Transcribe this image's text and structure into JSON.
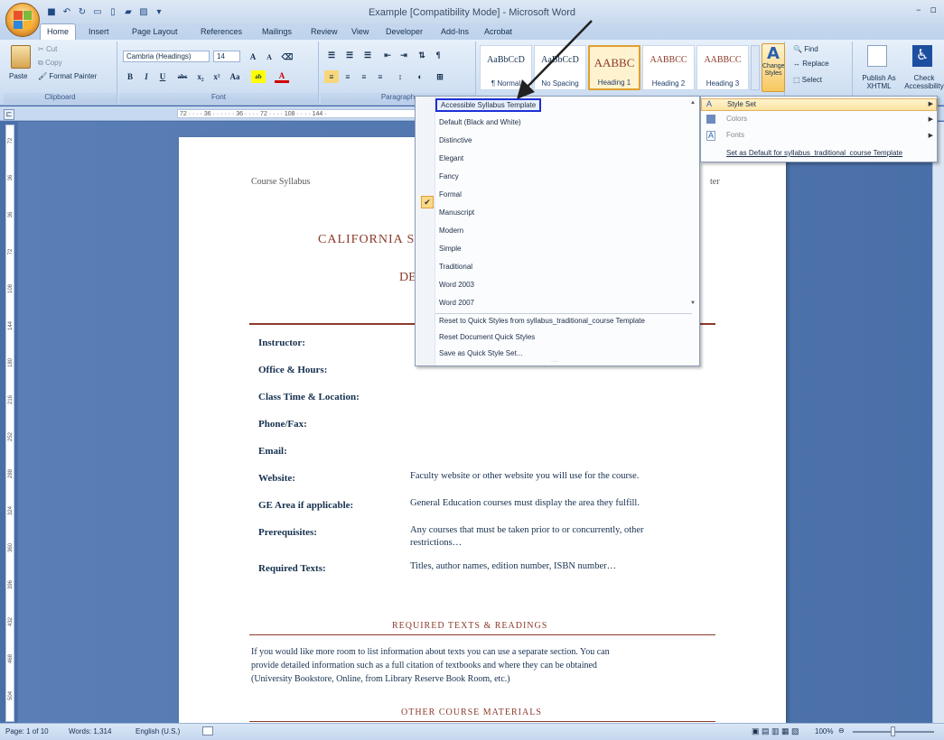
{
  "titlebar": {
    "title": "Example [Compatibility Mode] - Microsoft Word",
    "min": "–",
    "max": "▫",
    "close": "✕"
  },
  "tabs": [
    "Home",
    "Insert",
    "Page Layout",
    "References",
    "Mailings",
    "Review",
    "View",
    "Developer",
    "Add-Ins",
    "Acrobat"
  ],
  "clipboard": {
    "paste": "Paste",
    "cut": "Cut",
    "copy": "Copy",
    "format_painter": "Format Painter",
    "label": "Clipboard"
  },
  "font": {
    "name": "Cambria (Headings)",
    "size": "14",
    "label": "Font"
  },
  "paragraph": {
    "label": "Paragraph"
  },
  "styles": {
    "tiles": [
      {
        "sample": "AaBbCcD",
        "name": "¶ Normal"
      },
      {
        "sample": "AaBbCcD",
        "name": "No Spacing"
      },
      {
        "sample": "AABBC",
        "name": "Heading 1"
      },
      {
        "sample": "AABBCC",
        "name": "Heading 2"
      },
      {
        "sample": "AABBCC",
        "name": "Heading 3"
      }
    ],
    "change": "Change Styles"
  },
  "editing": {
    "find": "Find",
    "replace": "Replace",
    "select": "Select"
  },
  "publish": {
    "publish": "Publish As XHTML",
    "check": "Check Accessibility"
  },
  "ruler": {
    "text": "72 · · · · 36 · · · · · · 36 · · · · 72 · · · · 108 · · · · 144 ·"
  },
  "vruler": [
    "72",
    "36",
    "36",
    "72",
    "108",
    "144",
    "180",
    "216",
    "252",
    "288",
    "324",
    "360",
    "396",
    "432",
    "468",
    "504"
  ],
  "document": {
    "header_left": "Course Syllabus",
    "header_right": "ter",
    "title_partial": "CALIFORNIA S",
    "subtitle_partial": "DE",
    "fields": [
      {
        "label": "Instructor:",
        "value": ""
      },
      {
        "label": "Office & Hours:",
        "value": ""
      },
      {
        "label": "Class Time & Location:",
        "value": ""
      },
      {
        "label": "Phone/Fax:",
        "value": ""
      },
      {
        "label": "Email:",
        "value": ""
      },
      {
        "label": "Website:",
        "value": "Faculty website or other website you will use for the course."
      },
      {
        "label": "GE Area if applicable:",
        "value": "General Education courses must display the area they fulfill."
      },
      {
        "label": "Prerequisites:",
        "value": "Any courses that must be taken prior to or concurrently, other",
        "value2": "restrictions…"
      },
      {
        "label": "Required Texts:",
        "value": "Titles, author names, edition number, ISBN number…"
      }
    ],
    "section1": "REQUIRED TEXTS & READINGS",
    "para1": [
      "If you would like more room to list information about texts you can use a separate section.  You can",
      "provide detailed information such as a full citation of textbooks and where they can be obtained",
      "(University Bookstore, Online, from Library Reserve Book Room, etc.)"
    ],
    "section2": "OTHER COURSE MATERIALS"
  },
  "style_menu": {
    "items": [
      "Accessible Syllabus Template",
      "Default (Black and White)",
      "Distinctive",
      "Elegant",
      "Fancy",
      "Formal",
      "Manuscript",
      "Modern",
      "Simple",
      "Traditional",
      "Word 2003",
      "Word 2007"
    ],
    "checked": "Formal",
    "actions": [
      "Reset to Quick Styles from syllabus_traditional_course Template",
      "Reset Document Quick Styles",
      "Save as Quick Style Set..."
    ]
  },
  "submenu": {
    "items": [
      "Style Set",
      "Colors",
      "Fonts",
      "Set as Default for syllabus_traditional_course Template"
    ]
  },
  "statusbar": {
    "page": "Page: 1 of 10",
    "words": "Words: 1,314",
    "language": "English (U.S.)",
    "zoom": "100%"
  },
  "colors": {
    "accent": "#8b3a2a",
    "highlight_border": "#1f2fd6"
  }
}
